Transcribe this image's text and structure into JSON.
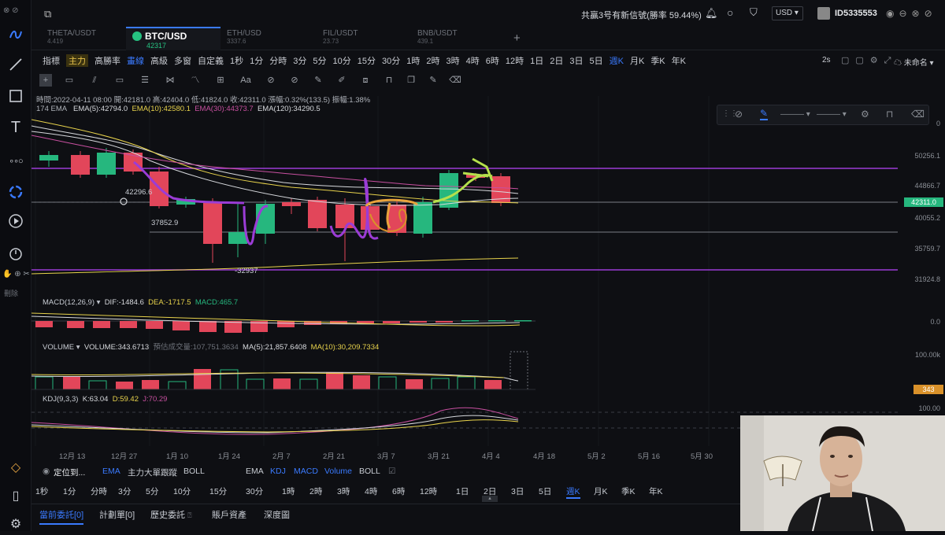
{
  "top": {
    "signal_text": "共贏3号有新信號(勝率 59.44%)",
    "currency": "USD",
    "user_id": "ID5335553"
  },
  "tabs": [
    {
      "name": "THETA/USDT",
      "price": "4.419"
    },
    {
      "name": "BTC/USD",
      "price": "42317"
    },
    {
      "name": "ETH/USD",
      "price": "3337.6"
    },
    {
      "name": "FIL/USDT",
      "price": "23.73"
    },
    {
      "name": "BNB/USDT",
      "price": "439.1"
    }
  ],
  "toolbar": {
    "items": [
      "指標",
      "主力",
      "高勝率",
      "畫線",
      "高級",
      "多窗",
      "自定義",
      "1秒",
      "1分",
      "分時",
      "3分",
      "5分",
      "10分",
      "15分",
      "30分",
      "1時",
      "2時",
      "3時",
      "4時",
      "6時",
      "12時",
      "1日",
      "2日",
      "3日",
      "5日",
      "週K",
      "月K",
      "季K",
      "年K"
    ],
    "refresh": "2s",
    "unnamed": "未命名"
  },
  "info": {
    "line1": "時間:2022-04-11 08:00  開:42181.0  高:42404.0  低:41824.0  收:42311.0  漲幅:0.32%(133.5)  振幅:1.38%",
    "ema_prefix": "174 EMA",
    "ema5": "EMA(5):42794.0",
    "ema10": "EMA(10):42580.1",
    "ema30": "EMA(30):44373.7",
    "ema120": "EMA(120):34290.5"
  },
  "price_axis": [
    "50256.1",
    "44866.7",
    "40055.2",
    "35759.7",
    "31924.8"
  ],
  "price_axis_top": "0",
  "current_price": "42311.0",
  "annotations": {
    "left_high": "42296.6",
    "mid_low": "37852.9",
    "bottom_low": "32937"
  },
  "macd": {
    "label": "MACD(12,26,9)",
    "dif": "DIF:-1484.6",
    "dea": "DEA:-1717.5",
    "macd": "MACD:465.7",
    "axis": "0.0"
  },
  "volume": {
    "label": "VOLUME",
    "value": "VOLUME:343.6713",
    "est": "預估成交量:107,751.3634",
    "ma5": "MA(5):21,857.6408",
    "ma10": "MA(10):30,209.7334",
    "axis": "100.00k",
    "badge": "343"
  },
  "kdj": {
    "label": "KDJ(9,3,3)",
    "k": "K:63.04",
    "d": "D:59.42",
    "j": "J:70.29",
    "axis": "100.00"
  },
  "x_axis": [
    "12月 13",
    "12月 27",
    "1月 10",
    "1月 24",
    "2月 7",
    "2月 21",
    "3月 7",
    "3月 21",
    "4月 4",
    "4月 18",
    "5月 2",
    "5月 16",
    "5月 30"
  ],
  "bottom_bar1": {
    "locate": "定位到...",
    "items": [
      "EMA",
      "主力大單跟蹤",
      "BOLL"
    ],
    "right": [
      "EMA",
      "KDJ",
      "MACD",
      "Volume",
      "BOLL"
    ]
  },
  "bottom_bar2": [
    "1秒",
    "1分",
    "分時",
    "3分",
    "5分",
    "10分",
    "15分",
    "30分",
    "1時",
    "2時",
    "3時",
    "4時",
    "6時",
    "12時",
    "1日",
    "2日",
    "3日",
    "5日",
    "週K",
    "月K",
    "季K",
    "年K"
  ],
  "bottom_tabs": [
    "當前委託[0]",
    "計劃單[0]",
    "歷史委託",
    "賬戶資產",
    "深度圖"
  ],
  "colors": {
    "up": "#26b77e",
    "down": "#e2465a",
    "accent": "#3a7afe",
    "purple_line": "#9b3cd6"
  }
}
